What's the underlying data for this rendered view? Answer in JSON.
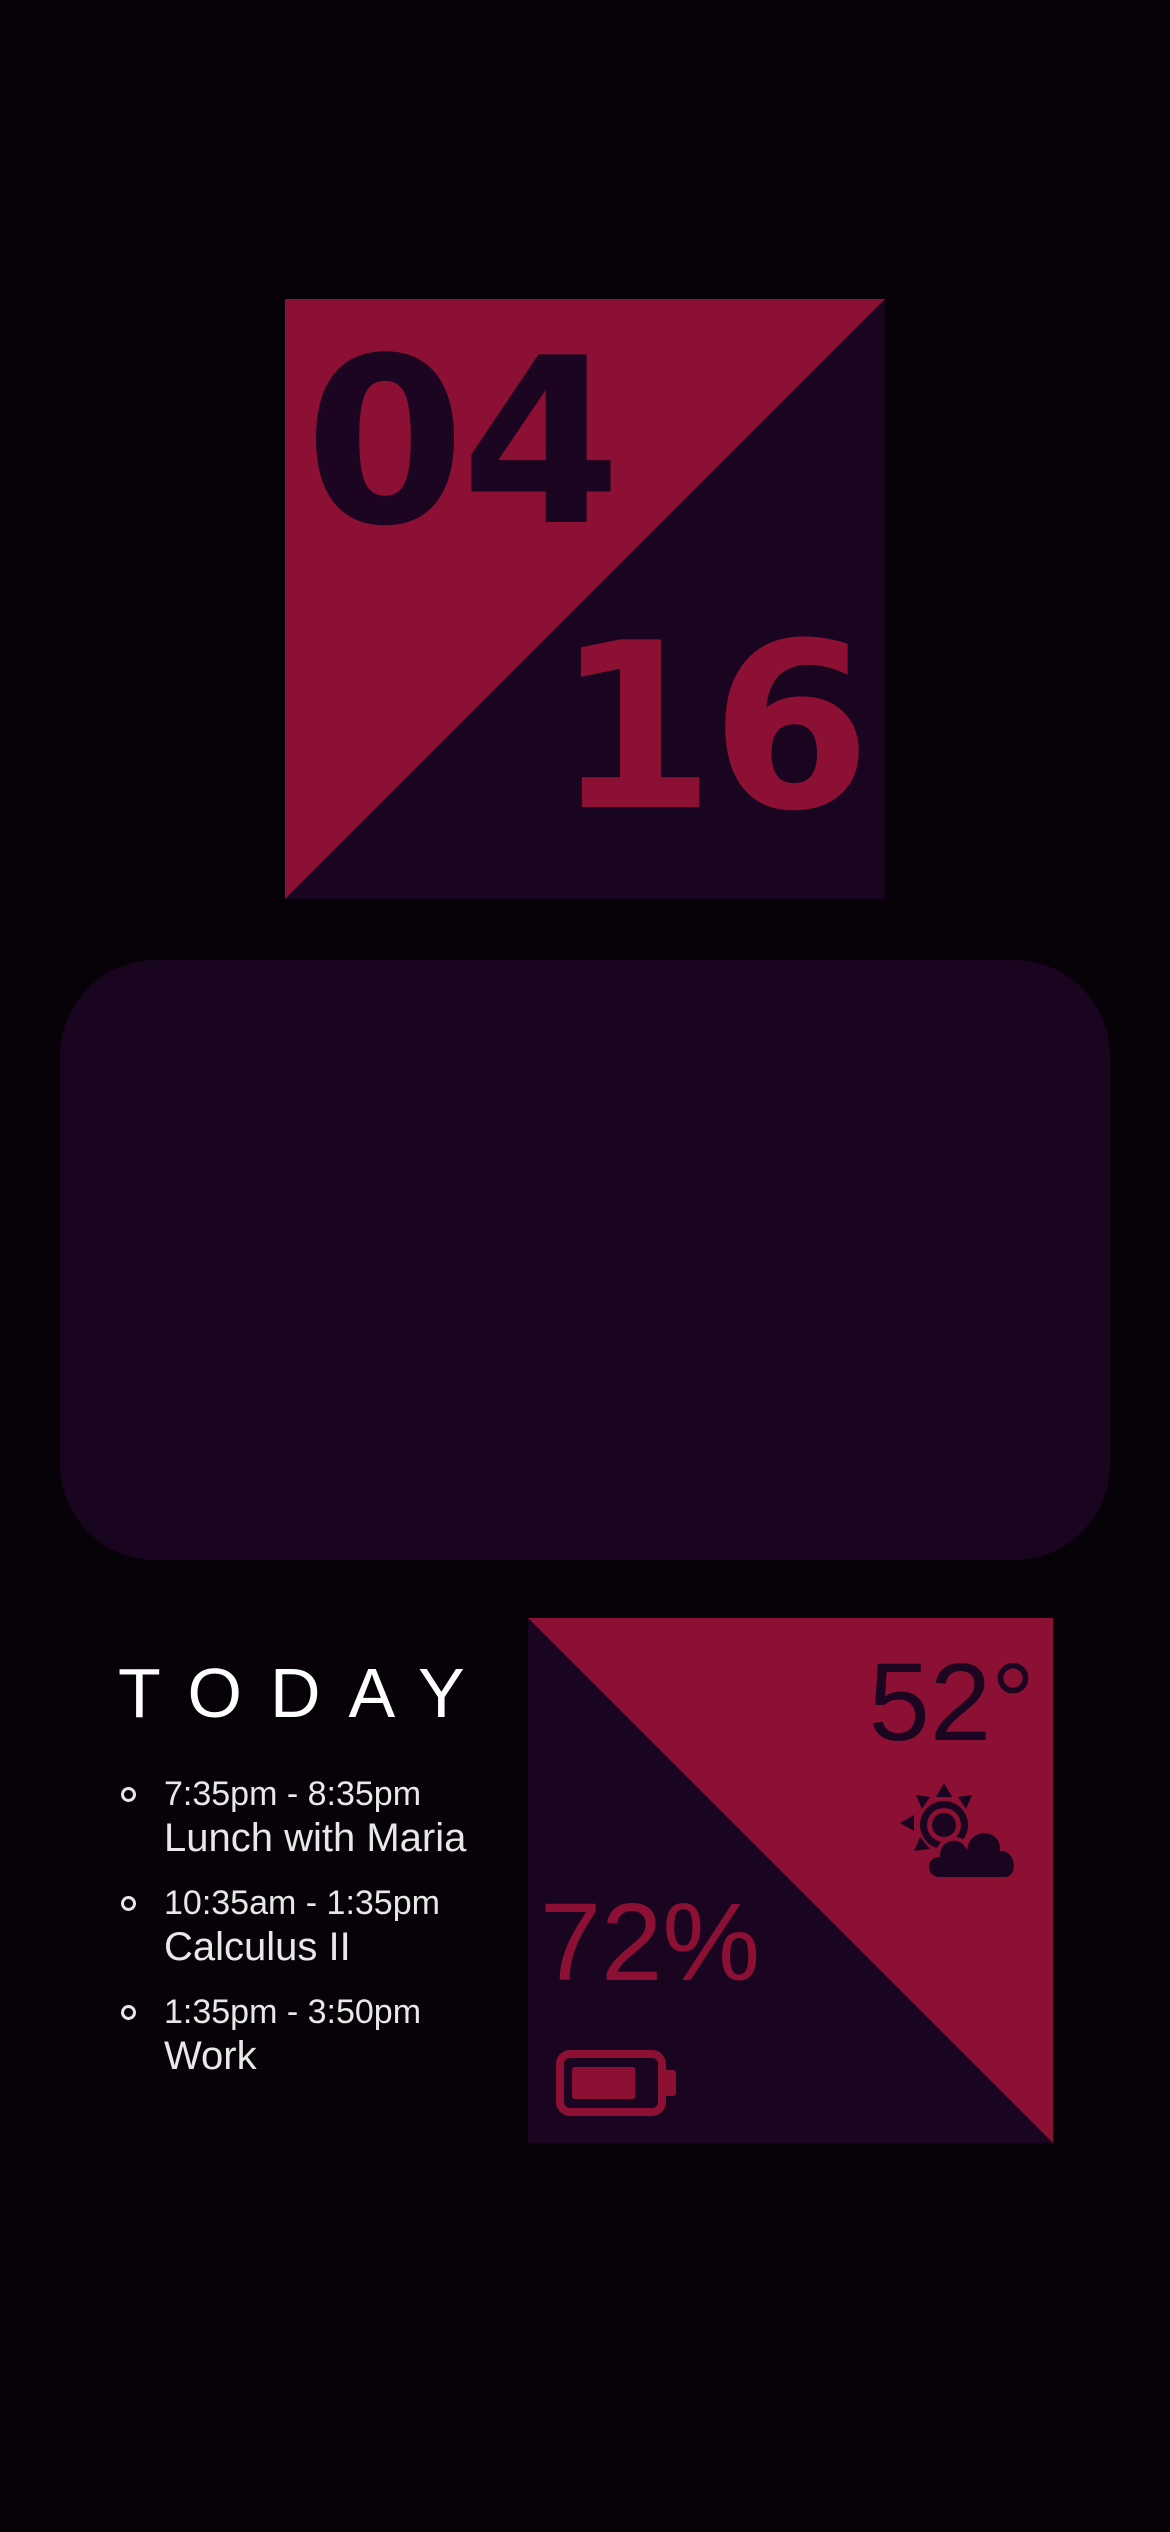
{
  "date": {
    "month": "04",
    "day": "16"
  },
  "agenda": {
    "title": "TODAY",
    "events": [
      {
        "time": "7:35pm - 8:35pm",
        "name": "Lunch with Maria"
      },
      {
        "time": "10:35am - 1:35pm",
        "name": "Calculus II"
      },
      {
        "time": "1:35pm - 3:50pm",
        "name": "Work"
      }
    ]
  },
  "status": {
    "temperature": "52°",
    "weather_icon": "partly-cloudy-icon",
    "battery_percent": "72%",
    "battery_level": 0.72,
    "battery_icon": "battery-icon"
  },
  "colors": {
    "background": "#060208",
    "accent": "#8c1034",
    "panel": "#19051f",
    "text": "#e8e8e8"
  }
}
